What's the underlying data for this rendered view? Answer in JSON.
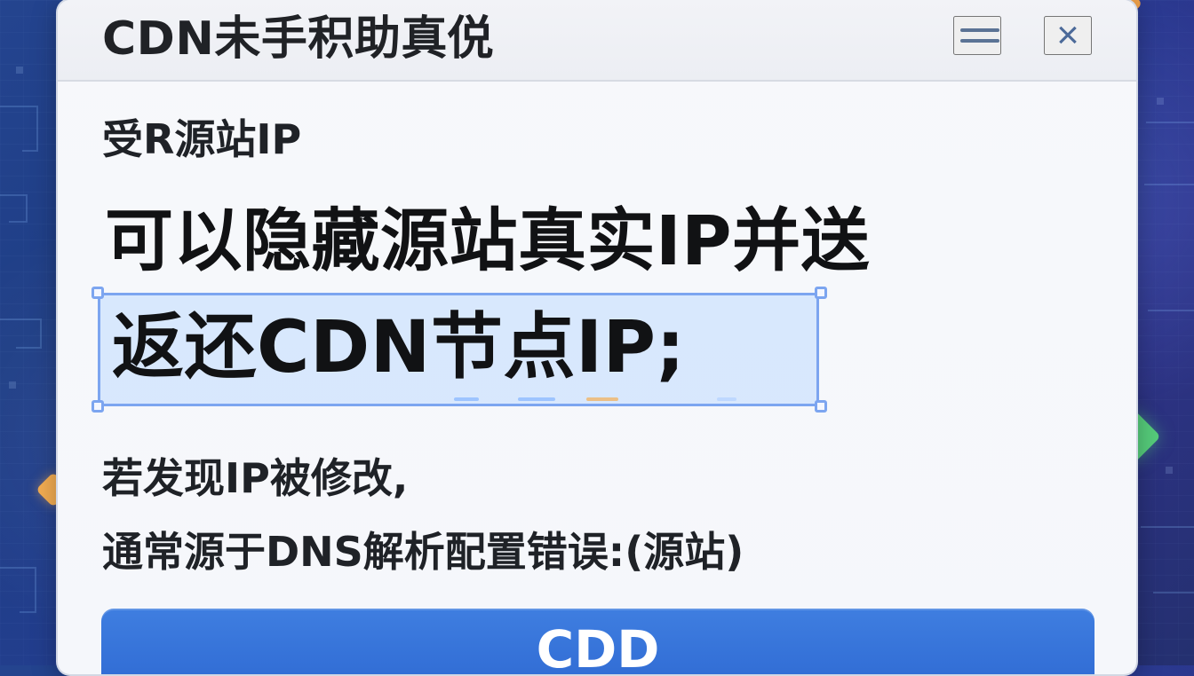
{
  "window": {
    "title": "CDN未手积助真侻"
  },
  "content": {
    "subheading": "受R源站IP",
    "main_line_1": "可以隐藏源站真实IP并送",
    "main_line_2": "返还CDN节点IP;",
    "body_line_1": "若发现IP被修改,",
    "body_line_2": "通常源于DNS解析配置错误:(源站)"
  },
  "actions": {
    "primary_button": "CDD"
  },
  "icons": {
    "menu": "menu-icon",
    "close": "close-icon"
  },
  "colors": {
    "accent": "#2f6ad3",
    "selection": "#7ca5f0"
  }
}
